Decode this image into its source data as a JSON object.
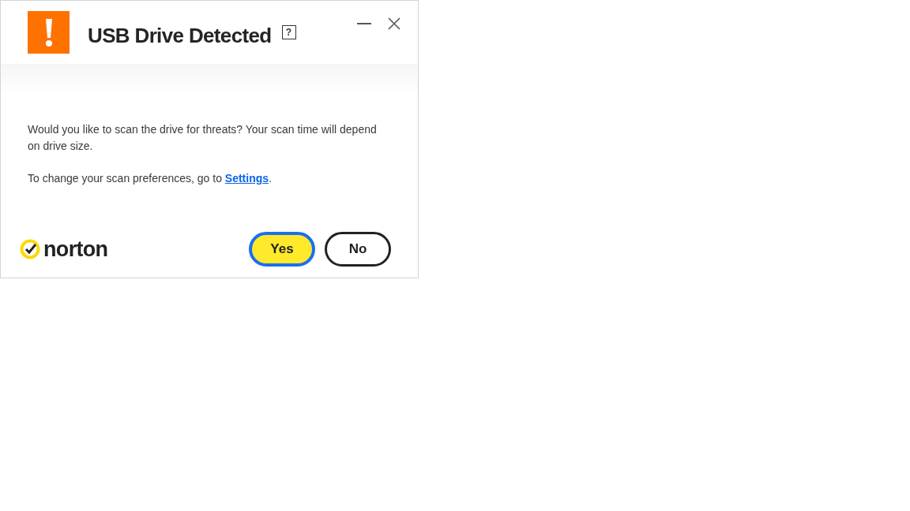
{
  "window": {
    "title": "USB Drive Detected",
    "help": "?"
  },
  "body": {
    "message": "Would you like to scan the drive for threats? Your scan time will depend on drive size.",
    "settings_prefix": "To change your scan preferences, go to ",
    "settings_link": "Settings",
    "settings_suffix": "."
  },
  "footer": {
    "logo": "norton",
    "buttons": [
      {
        "label": "Yes",
        "focused": true,
        "kind": "primary"
      },
      {
        "label": "No",
        "focused": false,
        "kind": "secondary"
      }
    ]
  }
}
